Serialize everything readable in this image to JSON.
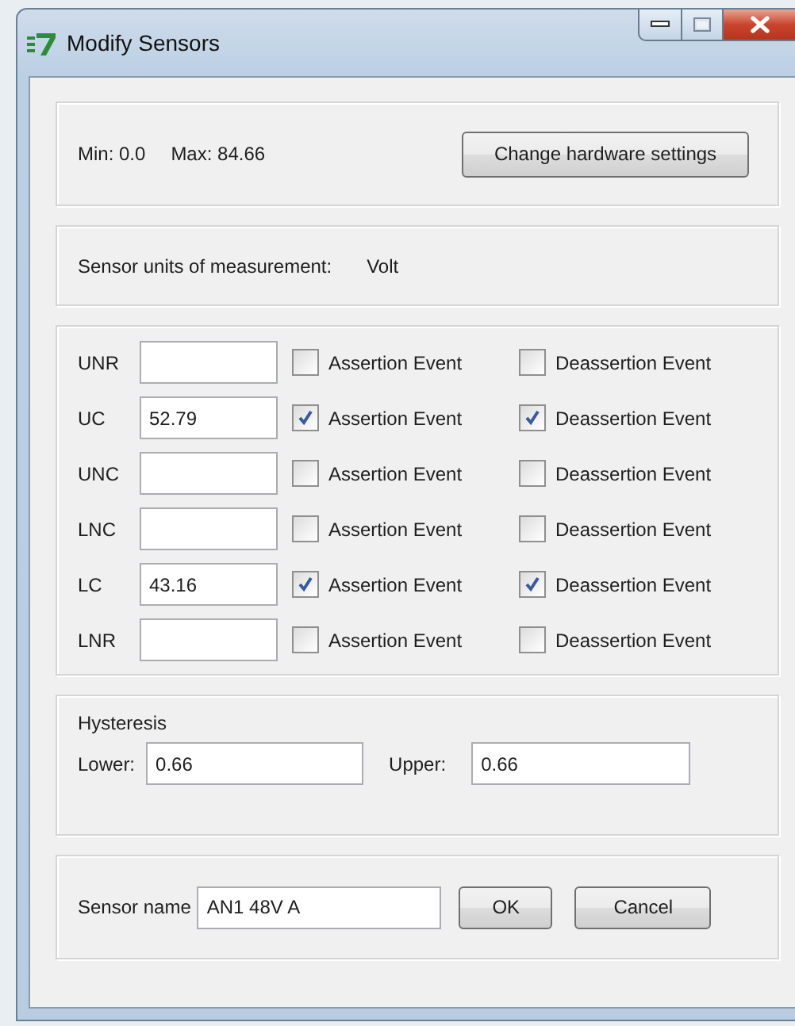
{
  "window": {
    "title": "Modify Sensors"
  },
  "range": {
    "min_text": "Min: 0.0",
    "max_text": "Max: 84.66",
    "button": "Change hardware settings"
  },
  "units": {
    "label": "Sensor units of measurement:",
    "value": "Volt"
  },
  "thresholds": [
    {
      "name": "UNR",
      "assertion": {
        "label": "Assertion Event",
        "checked": false
      },
      "deassertion": {
        "label": "Deassertion Event",
        "checked": false
      }
    },
    {
      "name": "UC",
      "value": "52.79",
      "assertion": {
        "label": "Assertion Event",
        "checked": true
      },
      "deassertion": {
        "label": "Deassertion Event",
        "checked": true
      }
    },
    {
      "name": "UNC",
      "assertion": {
        "label": "Assertion Event",
        "checked": false
      },
      "deassertion": {
        "label": "Deassertion Event",
        "checked": false
      }
    },
    {
      "name": "LNC",
      "assertion": {
        "label": "Assertion Event",
        "checked": false
      },
      "deassertion": {
        "label": "Deassertion Event",
        "checked": false
      }
    },
    {
      "name": "LC",
      "value": "43.16",
      "assertion": {
        "label": "Assertion Event",
        "checked": true
      },
      "deassertion": {
        "label": "Deassertion Event",
        "checked": true
      }
    },
    {
      "name": "LNR",
      "assertion": {
        "label": "Assertion Event",
        "checked": false
      },
      "deassertion": {
        "label": "Deassertion Event",
        "checked": false
      }
    }
  ],
  "hysteresis": {
    "title": "Hysteresis",
    "lower_label": "Lower:",
    "lower_value": "0.66",
    "upper_label": "Upper:",
    "upper_value": "0.66"
  },
  "sensor_name": {
    "label": "Sensor name",
    "value": "AN1 48V A"
  },
  "buttons": [
    "OK",
    "Cancel"
  ]
}
